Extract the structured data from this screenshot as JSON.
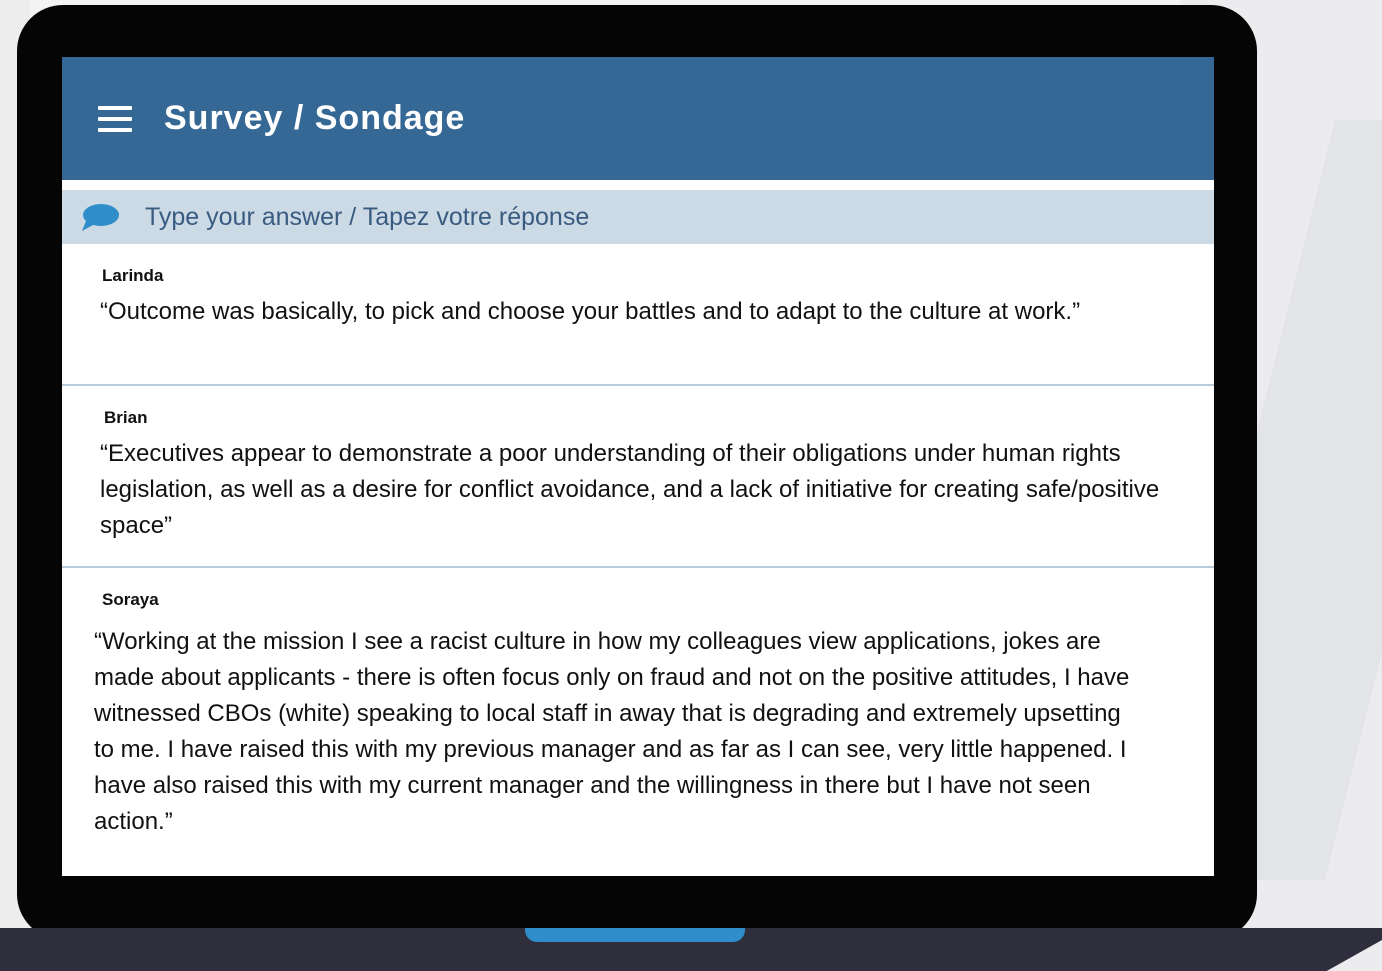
{
  "header": {
    "title": "Survey / Sondage"
  },
  "answer_input": {
    "placeholder": "Type your answer / Tapez votre réponse"
  },
  "responses": [
    {
      "name": "Larinda",
      "quote": "“Outcome was basically, to pick and choose your battles and to adapt to the culture at work.”"
    },
    {
      "name": "Brian",
      "quote": "“Executives appear to demonstrate a poor understanding of their obligations under human rights legislation, as well as a desire for conflict avoidance, and a lack of initiative for creating safe/positive space”"
    },
    {
      "name": "Soraya",
      "quote": "“Working at the mission I see a racist culture in how my colleagues view applications, jokes are made about applicants - there is often focus only on fraud and not on the positive attitudes, I have witnessed CBOs (white) speaking to local staff in away that is degrading and extremely upsetting to me. I have raised this with my previous manager and as far as I can see, very little happened. I have also raised this with my current manager and the willingness in there but I have not seen action.”"
    }
  ],
  "colors": {
    "header_bg": "#366896",
    "answer_bar_bg": "#ccdae6",
    "chat_icon": "#2f8ec9",
    "laptop_frame": "#050505",
    "laptop_base": "#2f2e3c",
    "laptop_notch": "#2f8ec9"
  },
  "icons": {
    "menu": "hamburger-icon",
    "answer": "speech-bubble-icon"
  }
}
